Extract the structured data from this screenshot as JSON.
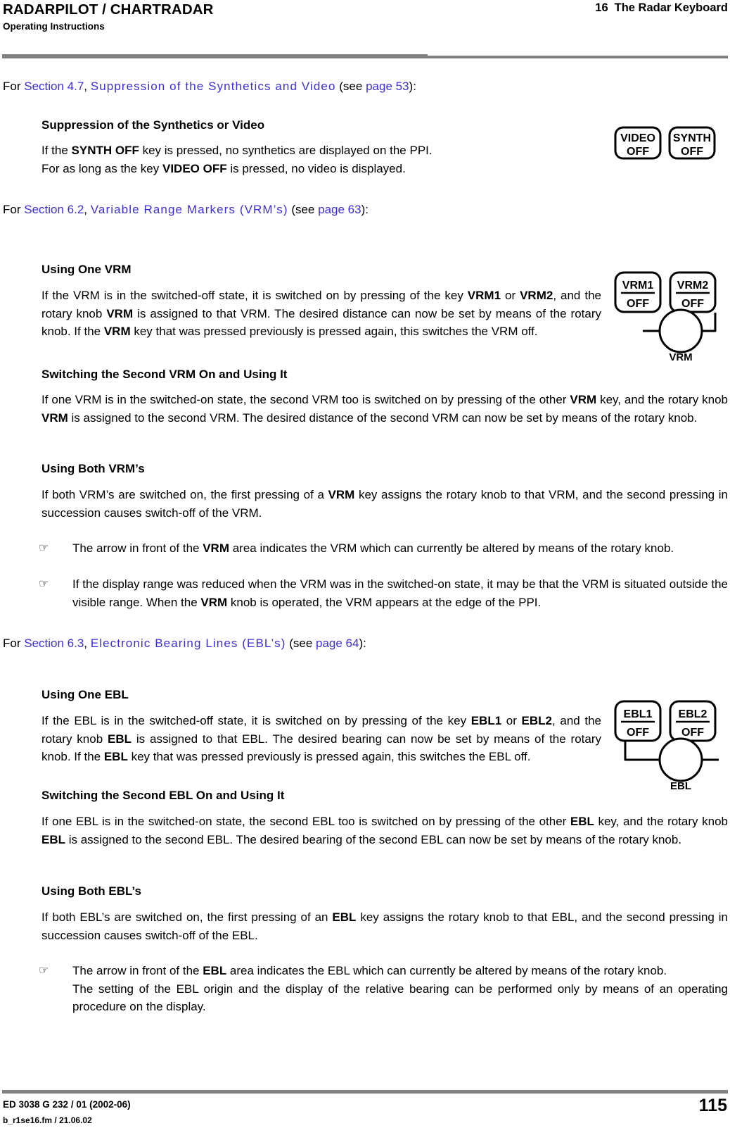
{
  "header": {
    "title": "RADARPILOT / CHARTRADAR",
    "subtitle": "Operating Instructions",
    "chapter_number": "16",
    "chapter_title": "The Radar Keyboard"
  },
  "footer": {
    "doc_id": "ED 3038 G 232 / 01 (2002-06)",
    "file_ref": "b_r1se16.fm / 21.06.02",
    "page_number": "115"
  },
  "colors": {
    "link": "#3a2ee0",
    "rule": "#808080",
    "text": "#000000"
  },
  "refs": {
    "ref1": {
      "lead": "For ",
      "section": "Section 4.7",
      "comma": ", ",
      "title": "Suppression of the Synthetics and Video",
      "see_open": " (see ",
      "page": "page 53",
      "see_close": "):"
    },
    "ref2": {
      "lead": "For ",
      "section": "Section 6.2",
      "comma": ", ",
      "title": "Variable Range Markers (VRM’s)",
      "see_open": " (see ",
      "page": "page 63",
      "see_close": "):"
    },
    "ref3": {
      "lead": "For ",
      "section": "Section 6.3",
      "comma": ", ",
      "title": "Electronic Bearing Lines (EBL’s)",
      "see_open": " (see ",
      "page": "page 64",
      "see_close": "):"
    }
  },
  "sections": {
    "s1": {
      "heading": "Suppression of the Synthetics or Video",
      "line1_a": "If the ",
      "line1_b": "SYNTH OFF",
      "line1_c": " key is pressed, no synthetics are displayed on the PPI.",
      "line2_a": "For as long as the key ",
      "line2_b": "VIDEO OFF",
      "line2_c": " is pressed, no video is displayed."
    },
    "s2": {
      "heading": "Using One VRM",
      "p_a": " If the VRM is in the switched-off state, it is switched on by pressing of the key ",
      "p_b": "VRM1",
      "p_c": " or ",
      "p_d": "VRM2",
      "p_e": ", and the rotary knob ",
      "p_f": "VRM",
      "p_g": " is assigned to that VRM. The desired distance can now be set by means of the rotary knob. If the ",
      "p_h": "VRM",
      "p_i": " key that was pressed previously is pressed again, this switches the VRM off."
    },
    "s3": {
      "heading": "Switching the Second VRM On and Using It",
      "p_a": "If one VRM is in the switched-on state, the second VRM too is switched on by pressing of the other ",
      "p_b": "VRM",
      "p_c": " key, and the rotary knob ",
      "p_d": "VRM",
      "p_e": " is assigned to the second VRM. The desired distance of the second VRM can now be set by means of the rotary knob."
    },
    "s4": {
      "heading": "Using Both VRM’s",
      "p_a": "If both VRM’s are switched on, the first pressing of a ",
      "p_b": "VRM",
      "p_c": " key assigns the rotary knob to that VRM, and the second pressing in succession causes switch-off of the VRM.",
      "b1_a": "The arrow in front of the ",
      "b1_b": "VRM",
      "b1_c": " area indicates the VRM which can currently be altered by means of the rotary knob.",
      "b2_a": "If the display range was reduced when the VRM was in the switched-on state, it may be that the VRM is situated outside the visible range. When the ",
      "b2_b": "VRM",
      "b2_c": " knob is operated, the VRM appears at the edge of the PPI."
    },
    "s5": {
      "heading": "Using One EBL",
      "p_a": "If the EBL is in the switched-off state, it is switched on by pressing of the key ",
      "p_b": "EBL1",
      "p_c": " or ",
      "p_d": "EBL2",
      "p_e": ", and the rotary knob ",
      "p_f": "EBL",
      "p_g": " is assigned to that EBL. The desired bearing can now be set by means of the rotary knob. If the ",
      "p_h": "EBL",
      "p_i": " key that was pressed previously is pressed again, this switches the EBL off."
    },
    "s6": {
      "heading": "Switching the Second EBL On and Using It",
      "p_a": "If one EBL is in the switched-on state, the second EBL too is switched on by pressing of the other ",
      "p_b": "EBL",
      "p_c": " key, and the rotary knob ",
      "p_d": "EBL",
      "p_e": " is assigned to the second EBL. The desired bearing of the second EBL can now be set by means of the rotary knob."
    },
    "s7": {
      "heading": "Using Both EBL’s",
      "p_a": "If both EBL’s are switched on, the first pressing of an ",
      "p_b": "EBL",
      "p_c": " key assigns the rotary knob to that EBL, and the second pressing in succession causes switch-off of the EBL.",
      "b1_a": "The arrow in front of the ",
      "b1_b": "EBL",
      "b1_c": " area indicates the EBL which can currently be altered by means of the rotary knob.",
      "b1_d": "The setting of the EBL origin and the display of the relative bearing can be performed only by means of an operating procedure on the display."
    }
  },
  "bullet_glyph": "☞",
  "keys": {
    "video_synth": {
      "key1_line1": "VIDEO",
      "key1_line2": "OFF",
      "key2_line1": "SYNTH",
      "key2_line2": "OFF"
    },
    "vrm": {
      "key1_line1": "VRM1",
      "key1_line2": "OFF",
      "key2_line1": "VRM2",
      "key2_line2": "OFF",
      "knob_label": "VRM"
    },
    "ebl": {
      "key1_line1": "EBL1",
      "key1_line2": "OFF",
      "key2_line1": "EBL2",
      "key2_line2": "OFF",
      "knob_label": "EBL"
    }
  }
}
